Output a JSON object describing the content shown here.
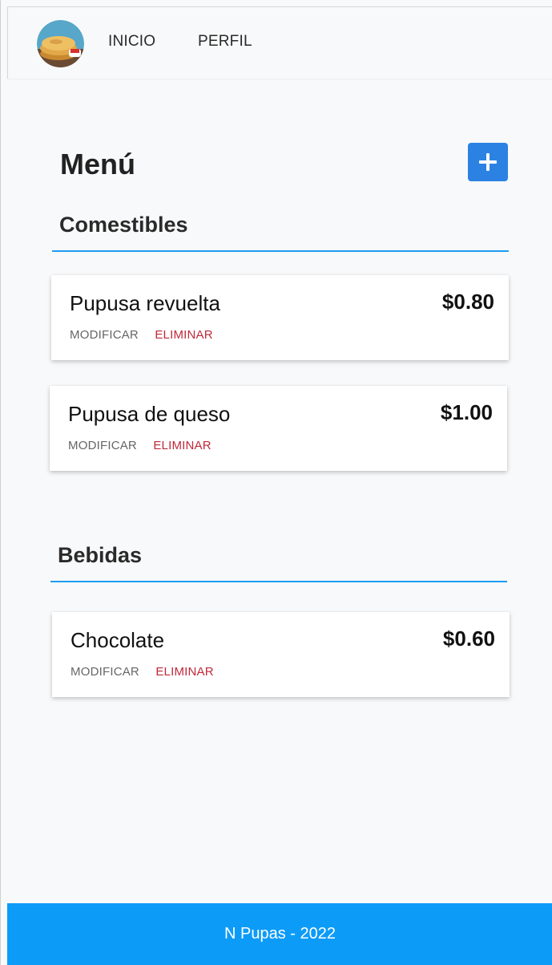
{
  "nav": {
    "links": [
      "INICIO",
      "PERFIL"
    ]
  },
  "page": {
    "title": "Menú",
    "add_icon": "plus-icon"
  },
  "sections": [
    {
      "title": "Comestibles",
      "items": [
        {
          "name": "Pupusa revuelta",
          "price": "$0.80",
          "modify": "MODIFICAR",
          "delete": "ELIMINAR"
        },
        {
          "name": "Pupusa de queso",
          "price": "$1.00",
          "modify": "MODIFICAR",
          "delete": "ELIMINAR"
        }
      ]
    },
    {
      "title": "Bebidas",
      "items": [
        {
          "name": "Chocolate",
          "price": "$0.60",
          "modify": "MODIFICAR",
          "delete": "ELIMINAR"
        }
      ]
    }
  ],
  "footer": {
    "text": "N Pupas - 2022"
  },
  "colors": {
    "accent": "#2b82e3",
    "rule": "#1e9bf2",
    "delete": "#c0283a",
    "footer": "#0d9bf8"
  }
}
